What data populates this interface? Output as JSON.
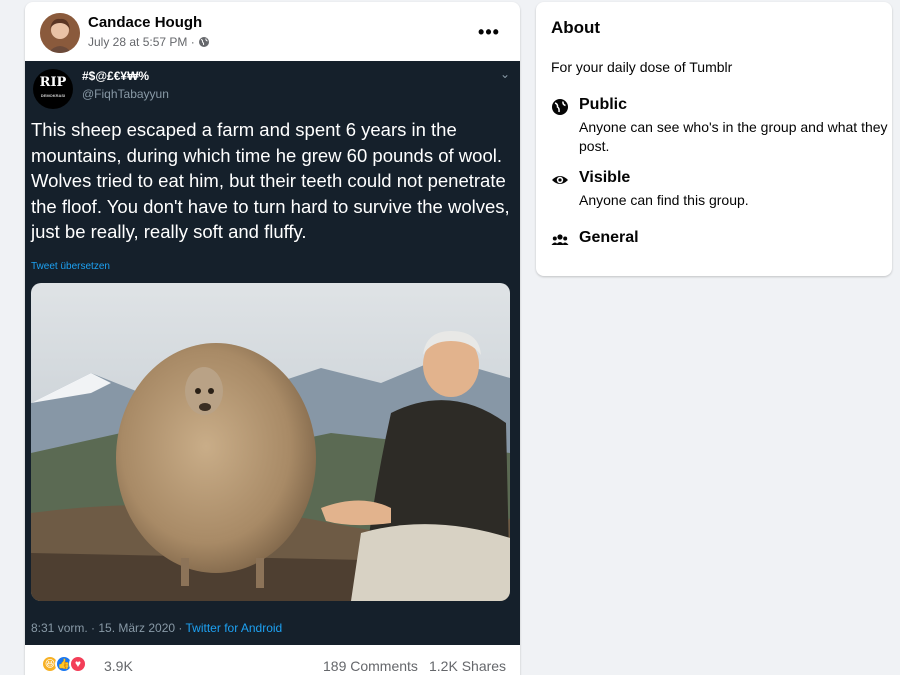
{
  "post": {
    "author": "Candace Hough",
    "meta_time": "July 28 at 5:57 PM ·",
    "more_label": "•••"
  },
  "tweet": {
    "avatar_text": "RIP",
    "avatar_sub": "DEMOKRASI",
    "display_name": "#$@£€¥₩%",
    "handle": "@FiqhTabayyun",
    "text": "This sheep escaped a farm and spent 6 years in the mountains, during which time he grew 60 pounds of wool. Wolves tried to eat him, but their teeth could not penetrate the floof. You don't have to turn hard to survive the wolves, just be really, really soft and fluffy.",
    "translate": "Tweet übersetzen",
    "timestamp": "8:31 vorm. · 15. März 2020 · ",
    "source": "Twitter for Android"
  },
  "reactions": {
    "count": "3.9K",
    "comments": "189 Comments",
    "shares": "1.2K Shares"
  },
  "about": {
    "title": "About",
    "description": "For your daily dose of Tumblr",
    "public_label": "Public",
    "public_sub": "Anyone can see who's in the group and what they post.",
    "visible_label": "Visible",
    "visible_sub": "Anyone can find this group.",
    "general_label": "General"
  },
  "colors": {
    "tweet_bg": "#15202b",
    "link": "#1da1f2",
    "page_bg": "#f0f2f5"
  }
}
